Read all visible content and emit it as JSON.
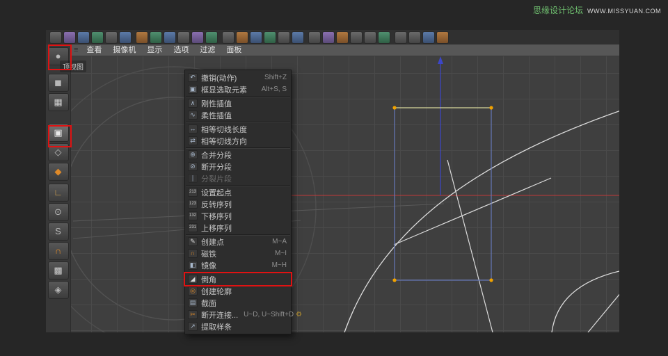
{
  "watermark": {
    "site_name": "思缘设计论坛",
    "site_url": "WWW.MISSYUAN.COM"
  },
  "viewport": {
    "label": "顶视图",
    "menu": [
      {
        "label": "查看"
      },
      {
        "label": "摄像机"
      },
      {
        "label": "显示"
      },
      {
        "label": "选项"
      },
      {
        "label": "过滤"
      },
      {
        "label": "面板"
      }
    ]
  },
  "left_toolbar": [
    {
      "name": "make-editable",
      "glyph": "●"
    },
    {
      "name": "model-mode",
      "glyph": "◼"
    },
    {
      "name": "texture-mode",
      "glyph": "▦"
    },
    {
      "name": "points-mode",
      "glyph": "▣"
    },
    {
      "name": "edges-mode",
      "glyph": "◇"
    },
    {
      "name": "polygons-mode",
      "glyph": "◆"
    },
    {
      "name": "enable-axis",
      "glyph": "∟"
    },
    {
      "name": "viewport-solo",
      "glyph": "⊙"
    },
    {
      "name": "snap",
      "glyph": "S"
    },
    {
      "name": "magnet-snap",
      "glyph": "∩"
    },
    {
      "name": "workplane-lock",
      "glyph": "▩"
    },
    {
      "name": "workplane",
      "glyph": "◈"
    }
  ],
  "context_menu": {
    "gear_glyph": "⚙",
    "items": [
      {
        "label": "撤销(动作)",
        "shortcut": "Shift+Z",
        "glyph": "↶"
      },
      {
        "label": "框显选取元素",
        "shortcut": "Alt+S, S",
        "glyph": "▣"
      },
      {
        "label": "刚性插值",
        "shortcut": "",
        "glyph": "∧"
      },
      {
        "label": "柔性插值",
        "shortcut": "",
        "glyph": "∿"
      },
      {
        "label": "相等切线长度",
        "shortcut": "",
        "glyph": "↔"
      },
      {
        "label": "相等切线方向",
        "shortcut": "",
        "glyph": "⇄"
      },
      {
        "label": "合并分段",
        "shortcut": "",
        "glyph": "⊕"
      },
      {
        "label": "断开分段",
        "shortcut": "",
        "glyph": "⊘"
      },
      {
        "label": "分裂片段",
        "shortcut": "",
        "glyph": "∥"
      },
      {
        "label": "设置起点",
        "shortcut": "",
        "glyph": "213"
      },
      {
        "label": "反转序列",
        "shortcut": "",
        "glyph": "123"
      },
      {
        "label": "下移序列",
        "shortcut": "",
        "glyph": "132"
      },
      {
        "label": "上移序列",
        "shortcut": "",
        "glyph": "231"
      },
      {
        "label": "创建点",
        "shortcut": "M~A",
        "glyph": "✎"
      },
      {
        "label": "磁铁",
        "shortcut": "M~I",
        "glyph": "∩"
      },
      {
        "label": "镜像",
        "shortcut": "M~H",
        "glyph": "◧"
      },
      {
        "label": "倒角",
        "shortcut": "",
        "glyph": "◢"
      },
      {
        "label": "创建轮廓",
        "shortcut": "",
        "glyph": "◎"
      },
      {
        "label": "截面",
        "shortcut": "",
        "glyph": "▤"
      },
      {
        "label": "断开连接...",
        "shortcut": "U~D, U~Shift+D",
        "glyph": "✂"
      },
      {
        "label": "提取样条",
        "shortcut": "",
        "glyph": "↗"
      }
    ]
  },
  "colors": {
    "annotation_red": "#e01212",
    "axis_x_red": "#c03a3a",
    "axis_y_blue": "#3c46c8",
    "spline_blue": "#6678b8",
    "spline_selected": "#d6d69c",
    "point_orange": "#f0a200",
    "watermark_green": "#6fbf6f"
  }
}
